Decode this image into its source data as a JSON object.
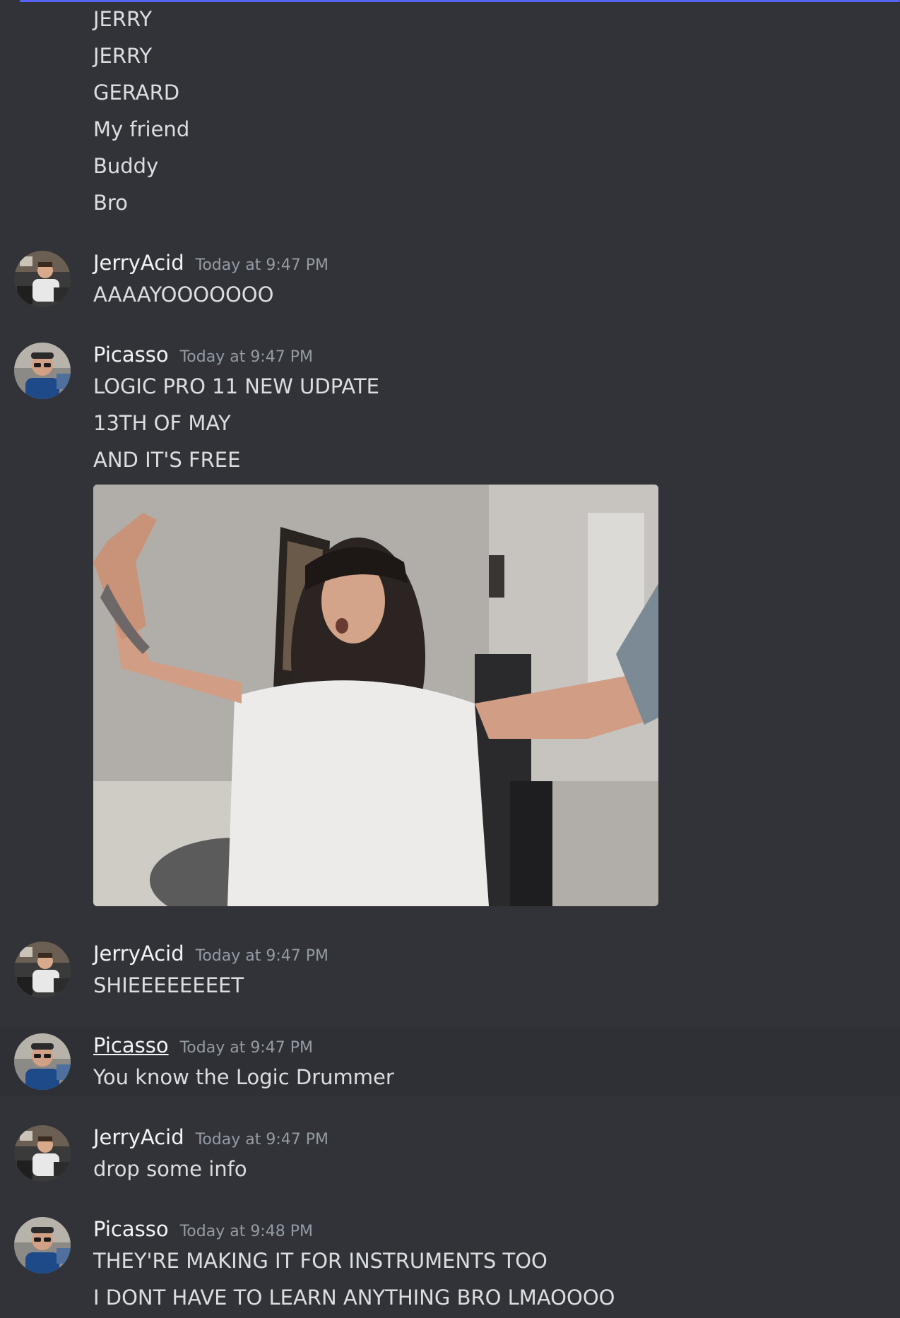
{
  "continuation_lines": [
    "JERRY",
    "JERRY",
    "GERARD",
    "My friend",
    "Buddy",
    "Bro"
  ],
  "messages": [
    {
      "author": "JerryAcid",
      "time": "Today at 9:47 PM",
      "lines": [
        "AAAAYOOOOOOO"
      ]
    },
    {
      "author": "Picasso",
      "time": "Today at 9:47 PM",
      "lines": [
        "LOGIC PRO 11 NEW UDPATE",
        "13TH OF MAY",
        "AND IT'S FREE"
      ],
      "attachment": "animated-gif"
    },
    {
      "author": "JerryAcid",
      "time": "Today at 9:47 PM",
      "lines": [
        "SHIEEEEEEEET"
      ]
    },
    {
      "author": "Picasso",
      "time": "Today at 9:47 PM",
      "lines": [
        "You know the Logic Drummer"
      ]
    },
    {
      "author": "JerryAcid",
      "time": "Today at 9:47 PM",
      "lines": [
        "drop some info"
      ]
    },
    {
      "author": "Picasso",
      "time": "Today at 9:48 PM",
      "lines": [
        "THEY'RE MAKING IT FOR INSTRUMENTS TOO",
        "I DONT HAVE TO LEARN ANYTHING BRO LMAOOOO"
      ]
    }
  ],
  "colors": {
    "background": "#313338",
    "hover_background": "#2e3035",
    "text": "#dbdee1",
    "username": "#f2f3f5",
    "timestamp": "#949ba4",
    "accent": "#5865f2"
  }
}
